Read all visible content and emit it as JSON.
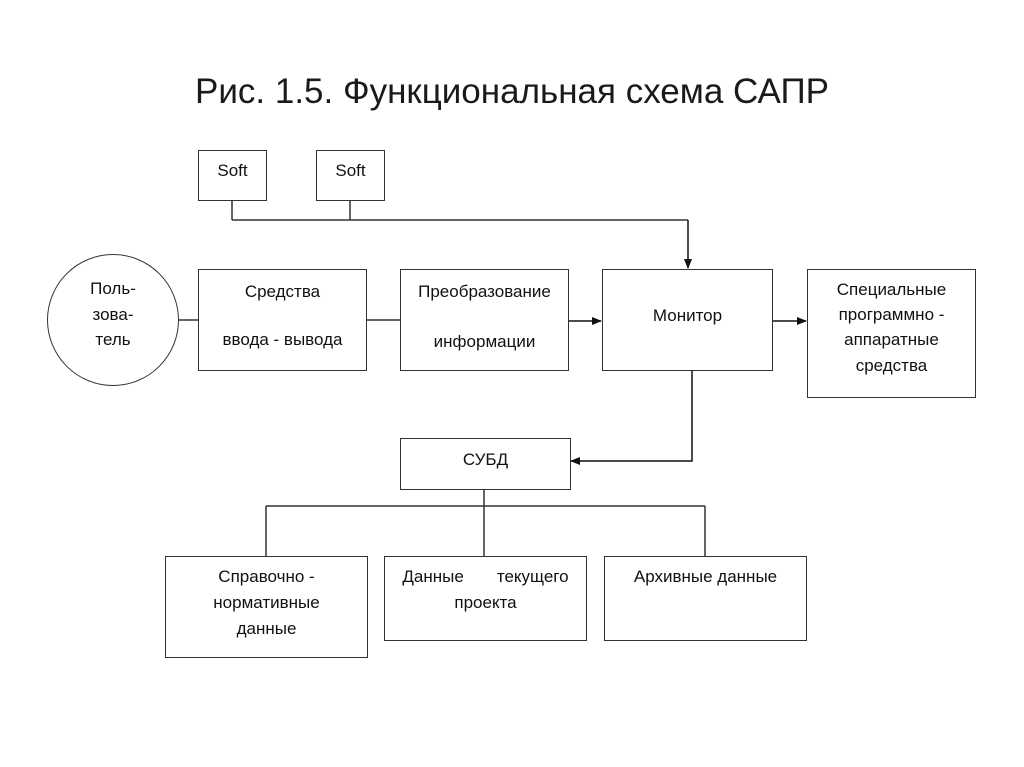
{
  "title": "Рис. 1.5. Функциональная схема САПР",
  "nodes": {
    "soft1": {
      "lines": [
        "Soft"
      ]
    },
    "soft2": {
      "lines": [
        "Soft"
      ]
    },
    "user": {
      "lines": [
        "Поль-",
        "зова-",
        "тель"
      ]
    },
    "io": {
      "lines": [
        "Средства",
        "ввода - вывода"
      ]
    },
    "transform": {
      "lines": [
        "Преобразование",
        "информации"
      ]
    },
    "monitor": {
      "lines": [
        "Монитор"
      ]
    },
    "special": {
      "lines": [
        "Специальные",
        "программно -",
        "аппаратные",
        "средства"
      ]
    },
    "dbms": {
      "lines": [
        "СУБД"
      ]
    },
    "reference": {
      "lines": [
        "Справочно -",
        "нормативные",
        "данные"
      ]
    },
    "current": {
      "lines": [
        "Данные       текущего",
        "проекта"
      ]
    },
    "archive": {
      "lines": [
        "Архивные данные"
      ]
    }
  },
  "edges": [
    {
      "from": "soft1",
      "to": "monitor",
      "arrow": true
    },
    {
      "from": "soft2",
      "to": "monitor",
      "arrow": true
    },
    {
      "from": "user",
      "to": "io",
      "arrow": false
    },
    {
      "from": "io",
      "to": "transform",
      "arrow": false
    },
    {
      "from": "transform",
      "to": "monitor",
      "arrow": true
    },
    {
      "from": "monitor",
      "to": "special",
      "arrow": true
    },
    {
      "from": "monitor",
      "to": "dbms",
      "arrow": true
    },
    {
      "from": "dbms",
      "to": "reference",
      "arrow": false
    },
    {
      "from": "dbms",
      "to": "current",
      "arrow": false
    },
    {
      "from": "dbms",
      "to": "archive",
      "arrow": false
    }
  ]
}
